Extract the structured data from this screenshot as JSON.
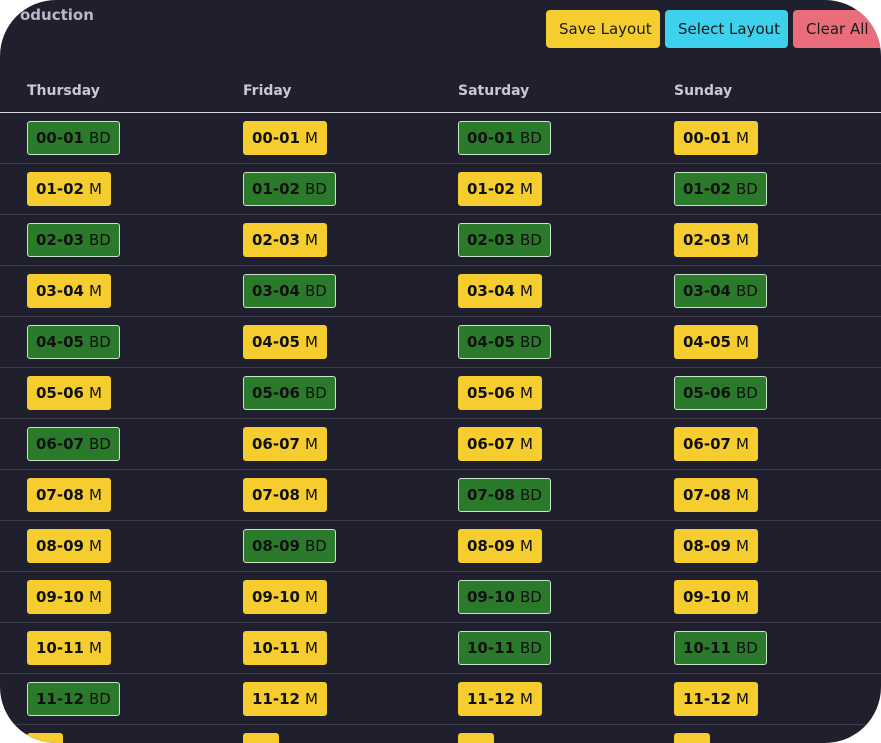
{
  "page": {
    "title_fragment": "oduction"
  },
  "toolbar": {
    "save_label": "Save Layout",
    "select_label": "Select Layout",
    "clear_label": "Clear All"
  },
  "colors": {
    "M": "#f5cd2e",
    "BD": "#2b7a2b",
    "background": "#1f1f2e",
    "save": "#f5cd2e",
    "select": "#3ed1ee",
    "clear": "#e96d7b"
  },
  "days": [
    "Thursday",
    "Friday",
    "Saturday",
    "Sunday"
  ],
  "rows": [
    {
      "range": "00-01",
      "types": [
        "BD",
        "M",
        "BD",
        "M"
      ]
    },
    {
      "range": "01-02",
      "types": [
        "M",
        "BD",
        "M",
        "BD"
      ]
    },
    {
      "range": "02-03",
      "types": [
        "BD",
        "M",
        "BD",
        "M"
      ]
    },
    {
      "range": "03-04",
      "types": [
        "M",
        "BD",
        "M",
        "BD"
      ]
    },
    {
      "range": "04-05",
      "types": [
        "BD",
        "M",
        "BD",
        "M"
      ]
    },
    {
      "range": "05-06",
      "types": [
        "M",
        "BD",
        "M",
        "BD"
      ]
    },
    {
      "range": "06-07",
      "types": [
        "BD",
        "M",
        "M",
        "M"
      ]
    },
    {
      "range": "07-08",
      "types": [
        "M",
        "M",
        "BD",
        "M"
      ]
    },
    {
      "range": "08-09",
      "types": [
        "M",
        "BD",
        "M",
        "M"
      ]
    },
    {
      "range": "09-10",
      "types": [
        "M",
        "M",
        "BD",
        "M"
      ]
    },
    {
      "range": "10-11",
      "types": [
        "M",
        "M",
        "BD",
        "BD"
      ]
    },
    {
      "range": "11-12",
      "types": [
        "BD",
        "M",
        "M",
        "M"
      ]
    },
    {
      "range": "",
      "types": [
        "M",
        "M",
        "M",
        "M"
      ]
    }
  ]
}
